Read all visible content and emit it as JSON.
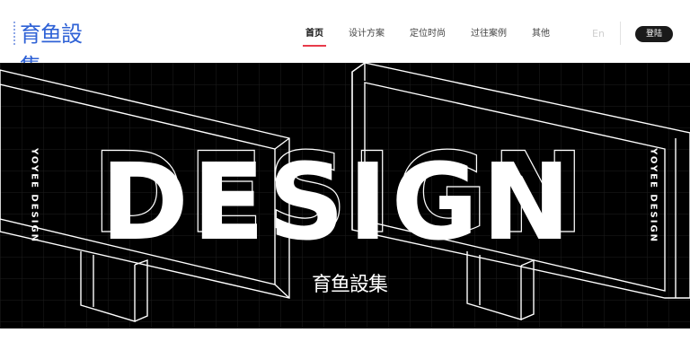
{
  "header": {
    "logo_text": "育鱼設集",
    "nav": [
      {
        "label": "首页",
        "active": true
      },
      {
        "label": "设计方案",
        "active": false
      },
      {
        "label": "定位时尚",
        "active": false
      },
      {
        "label": "过往案例",
        "active": false
      },
      {
        "label": "其他",
        "active": false
      }
    ],
    "lang_label": "En",
    "login_label": "登陆"
  },
  "banner": {
    "headline": "DESIGN",
    "side_left": "YOYEE DESIGN",
    "side_right": "YOYEE DESIGN",
    "logo_text": "育鱼設集"
  },
  "colors": {
    "brand_blue": "#2f62d6",
    "active_underline": "#e83b4a",
    "banner_bg": "#000000"
  }
}
